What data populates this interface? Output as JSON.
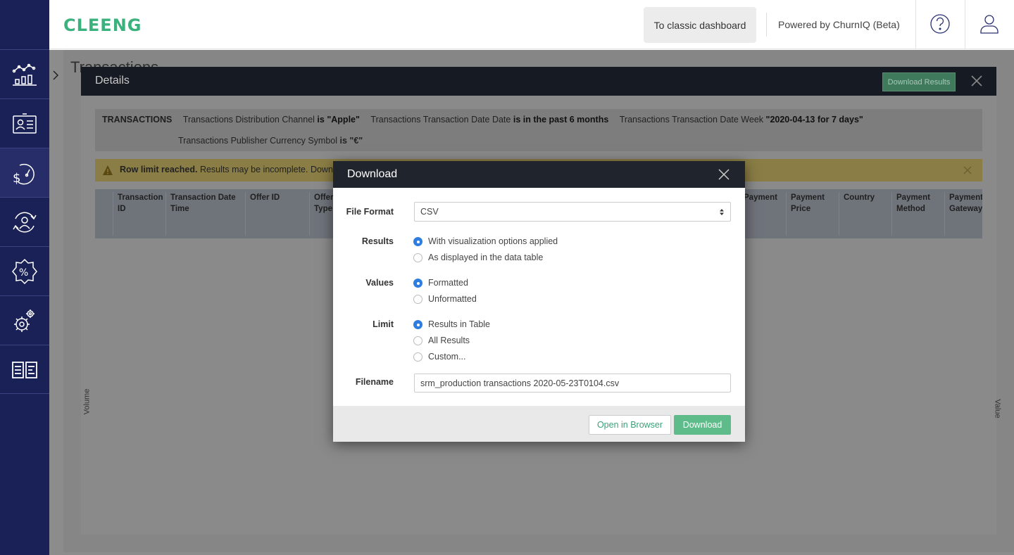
{
  "header": {
    "logo": "CLEENG",
    "classic_button": "To classic dashboard",
    "powered_by": "Powered by ChurnIQ (Beta)"
  },
  "sidebar": {
    "items": [
      {
        "icon": "analytics-chart-icon"
      },
      {
        "icon": "customer-card-icon"
      },
      {
        "icon": "revenue-gauge-icon"
      },
      {
        "icon": "churn-user-icon"
      },
      {
        "icon": "discount-badge-icon"
      },
      {
        "icon": "settings-gears-icon"
      },
      {
        "icon": "documentation-book-icon"
      }
    ]
  },
  "page": {
    "title": "Transactions"
  },
  "details": {
    "title": "Details",
    "download_results": "Download Results",
    "filters": {
      "label": "TRANSACTIONS",
      "row1": [
        {
          "field": "Transactions Distribution Channel",
          "op": "is",
          "value": "\"Apple\""
        },
        {
          "field": "Transactions Transaction Date Date",
          "op": "is in the past 6 months",
          "value": ""
        },
        {
          "field": "Transactions Transaction Date Week",
          "op": "",
          "value": "\"2020-04-13 for 7 days\""
        }
      ],
      "row2": [
        {
          "field": "Transactions Publisher Currency Symbol",
          "op": "is",
          "value": "\"€\""
        }
      ]
    },
    "warning": {
      "bold": "Row limit reached.",
      "text": "Results may be incomplete. Down"
    },
    "columns": [
      "Transaction ID",
      "Transaction Date Time",
      "Offer ID",
      "Offer Type",
      "Payment",
      "Payment Price",
      "Country",
      "Payment Method",
      "Payment Gateway"
    ],
    "axis_left": "Volume",
    "axis_right": "Value"
  },
  "modal": {
    "title": "Download",
    "file_format_label": "File Format",
    "file_format_value": "CSV",
    "results_label": "Results",
    "results_options": [
      "With visualization options applied",
      "As displayed in the data table"
    ],
    "results_selected": 0,
    "values_label": "Values",
    "values_options": [
      "Formatted",
      "Unformatted"
    ],
    "values_selected": 0,
    "limit_label": "Limit",
    "limit_options": [
      "Results in Table",
      "All Results",
      "Custom..."
    ],
    "limit_selected": 0,
    "filename_label": "Filename",
    "filename_value": "srm_production transactions 2020-05-23T0104.csv",
    "open_button": "Open in Browser",
    "download_button": "Download"
  },
  "colors": {
    "sidebar": "#1a2156",
    "brand_green": "#3bb27e",
    "radio_blue": "#2e7de1",
    "download_green": "#5dbc8a"
  }
}
